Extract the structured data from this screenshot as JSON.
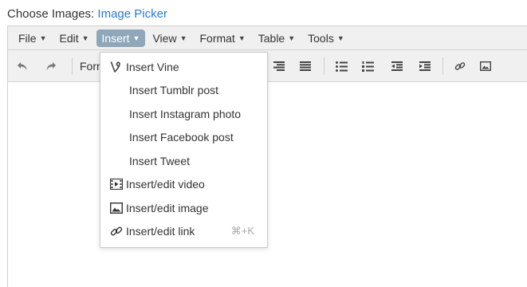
{
  "page": {
    "label": "Choose Images:",
    "link": "Image Picker"
  },
  "menubar": {
    "items": [
      {
        "label": "File",
        "active": false
      },
      {
        "label": "Edit",
        "active": false
      },
      {
        "label": "Insert",
        "active": true
      },
      {
        "label": "View",
        "active": false
      },
      {
        "label": "Format",
        "active": false
      },
      {
        "label": "Table",
        "active": false
      },
      {
        "label": "Tools",
        "active": false
      }
    ]
  },
  "toolbar": {
    "format_label": "Formats",
    "icons": [
      "undo-icon",
      "redo-icon",
      "align-right-icon",
      "align-justify-icon",
      "bullet-list-icon",
      "numbered-list-icon",
      "outdent-icon",
      "indent-icon",
      "link-icon",
      "image-icon"
    ]
  },
  "insert_menu": {
    "items": [
      {
        "label": "Insert Vine",
        "icon": "vine-icon",
        "shortcut": ""
      },
      {
        "label": "Insert Tumblr post",
        "icon": "",
        "shortcut": ""
      },
      {
        "label": "Insert Instagram photo",
        "icon": "",
        "shortcut": ""
      },
      {
        "label": "Insert Facebook post",
        "icon": "",
        "shortcut": ""
      },
      {
        "label": "Insert Tweet",
        "icon": "",
        "shortcut": ""
      },
      {
        "label": "Insert/edit video",
        "icon": "video-icon",
        "shortcut": ""
      },
      {
        "label": "Insert/edit image",
        "icon": "image-icon",
        "shortcut": ""
      },
      {
        "label": "Insert/edit link",
        "icon": "link-icon",
        "shortcut": "⌘+K"
      }
    ]
  },
  "colors": {
    "link": "#2a7bd1",
    "active_menu": "#8fa7b8",
    "bar_bg": "#f0f0f0"
  }
}
